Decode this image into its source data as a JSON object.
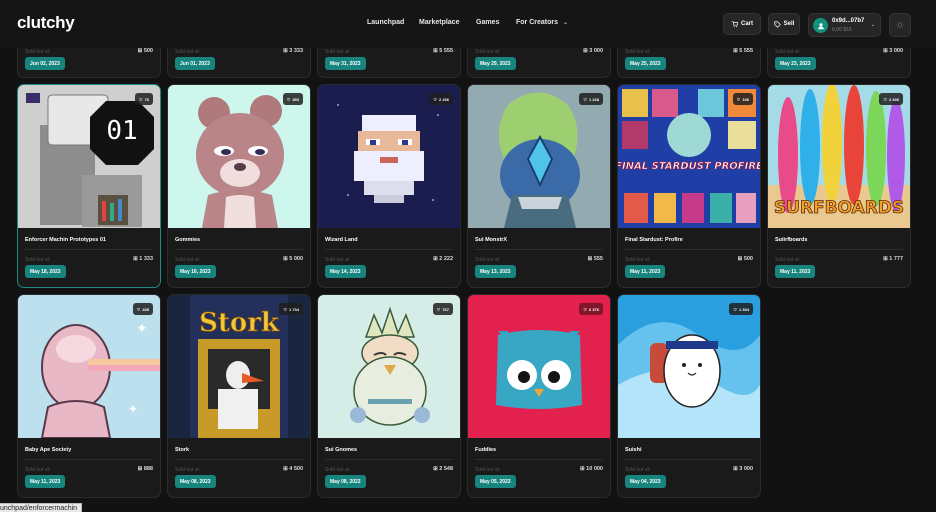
{
  "header": {
    "logo": "clutchy",
    "nav": [
      "Launchpad",
      "Marketplace",
      "Games",
      "For Creators"
    ],
    "cart_label": "Cart",
    "sell_label": "Sell",
    "wallet_address": "0x9d...07b7",
    "wallet_balance": "0.00 SUI"
  },
  "sold_out_label": "Sold out at:",
  "top_row": [
    {
      "supply": "500",
      "date": "Jun 02, 2023"
    },
    {
      "supply": "3 333",
      "date": "Jun 01, 2023"
    },
    {
      "supply": "5 555",
      "date": "May 31, 2023"
    },
    {
      "supply": "3 000",
      "date": "May 29, 2023"
    },
    {
      "supply": "5 555",
      "date": "May 25, 2023"
    },
    {
      "supply": "3 000",
      "date": "May 23, 2023"
    }
  ],
  "row1": [
    {
      "name": "Enforcer Machin Prototypes 01",
      "likes": "76",
      "supply": "1 333",
      "date": "May 18, 2023",
      "art_text": "01"
    },
    {
      "name": "Gommies",
      "likes": "393",
      "supply": "5 000",
      "date": "May 16, 2023"
    },
    {
      "name": "Wizard Land",
      "likes": "2 236",
      "supply": "2 222",
      "date": "May 14, 2023"
    },
    {
      "name": "Sui MonstrX",
      "likes": "1 228",
      "supply": "555",
      "date": "May 13, 2023"
    },
    {
      "name": "Final Stardust: Profire",
      "likes": "106",
      "supply": "500",
      "date": "May 11, 2023",
      "art_text": "FINAL STARDUST PROFIRE"
    },
    {
      "name": "Suiirfboards",
      "likes": "2 346",
      "supply": "1 777",
      "date": "May 11, 2023",
      "art_text": "SURFBOARDS"
    }
  ],
  "row2": [
    {
      "name": "Baby Ape Society",
      "likes": "435",
      "supply": "888",
      "date": "May 11, 2023"
    },
    {
      "name": "Stork",
      "likes": "1 734",
      "supply": "4 500",
      "date": "May 08, 2023",
      "art_text": "Stork"
    },
    {
      "name": "Sui Gnomes",
      "likes": "767",
      "supply": "2 548",
      "date": "May 08, 2023"
    },
    {
      "name": "Fuddies",
      "likes": "6 376",
      "supply": "10 000",
      "date": "May 05, 2023"
    },
    {
      "name": "Suishi",
      "likes": "1 334",
      "supply": "3 000",
      "date": "May 04, 2023"
    }
  ],
  "status_url": "unchpad/enforcermachin",
  "colors": {
    "accent": "#18847e",
    "background": "#121212",
    "card": "#1a1a1a"
  }
}
